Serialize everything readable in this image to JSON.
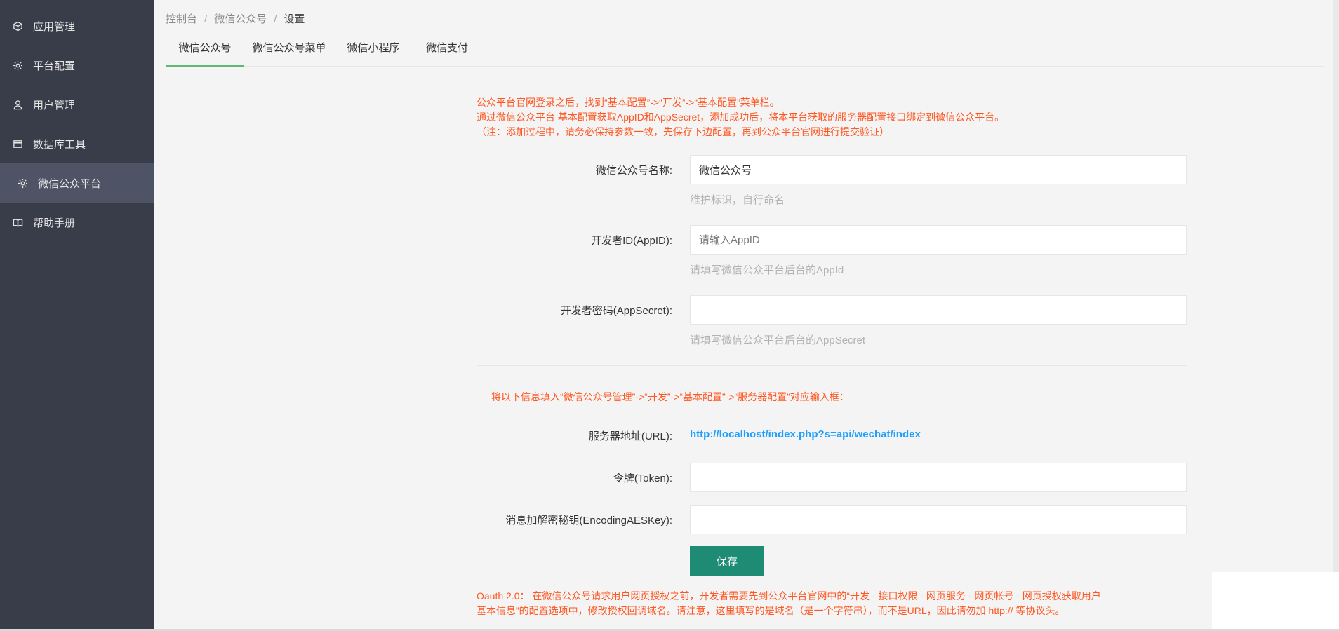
{
  "sidebar": {
    "items": [
      {
        "label": "应用管理",
        "icon": "cube-icon"
      },
      {
        "label": "平台配置",
        "icon": "gear-icon"
      },
      {
        "label": "用户管理",
        "icon": "user-icon"
      },
      {
        "label": "数据库工具",
        "icon": "window-icon"
      },
      {
        "label": "微信公众平台",
        "icon": "gear-icon",
        "active": true
      },
      {
        "label": "帮助手册",
        "icon": "book-icon"
      }
    ]
  },
  "breadcrumb": {
    "items": [
      "控制台",
      "微信公众号",
      "设置"
    ],
    "separator": "/"
  },
  "tabs": [
    {
      "label": "微信公众号",
      "active": true
    },
    {
      "label": "微信公众号菜单"
    },
    {
      "label": "微信小程序"
    },
    {
      "label": "微信支付"
    }
  ],
  "notes": {
    "line1": "公众平台官网登录之后，找到“基本配置”->“开发”->“基本配置”菜单栏。",
    "line2": "通过微信公众平台 基本配置获取AppID和AppSecret，添加成功后，将本平台获取的服务器配置接口绑定到微信公众平台。",
    "line3": "（注：添加过程中，请务必保持参数一致，先保存下边配置，再到公众平台官网进行提交验证）",
    "server_hint": "将以下信息填入“微信公众号管理”->“开发”->“基本配置”->“服务器配置”对应输入框：",
    "oauth1": "Oauth 2.0：  在微信公众号请求用户网页授权之前，开发者需要先到公众平台官网中的“开发 - 接口权限 - 网页服务 - 网页帐号 - 网页授权获取用户",
    "oauth2": "基本信息”的配置选项中，修改授权回调域名。请注意，这里填写的是域名（是一个字符串），而不是URL，因此请勿加 http:// 等协议头。"
  },
  "form": {
    "name": {
      "label": "微信公众号名称:",
      "value": "微信公众号",
      "help": "维护标识，自行命名"
    },
    "appid": {
      "label": "开发者ID(AppID):",
      "value": "",
      "placeholder": "请输入AppID",
      "help": "请填写微信公众平台后台的AppId"
    },
    "secret": {
      "label": "开发者密码(AppSecret):",
      "value": "",
      "help": "请填写微信公众平台后台的AppSecret"
    },
    "url": {
      "label": "服务器地址(URL):",
      "value": "http://localhost/index.php?s=api/wechat/index"
    },
    "token": {
      "label": "令牌(Token):",
      "value": ""
    },
    "aeskey": {
      "label": "消息加解密秘钥(EncodingAESKey):",
      "value": ""
    },
    "save_label": "保存"
  },
  "colors": {
    "sidebar_bg": "#393d49",
    "sidebar_active": "#4e5465",
    "accent_green": "#5fb878",
    "button": "#1e8b75",
    "warning_text": "#ff5722",
    "link_blue": "#1e9fff"
  }
}
